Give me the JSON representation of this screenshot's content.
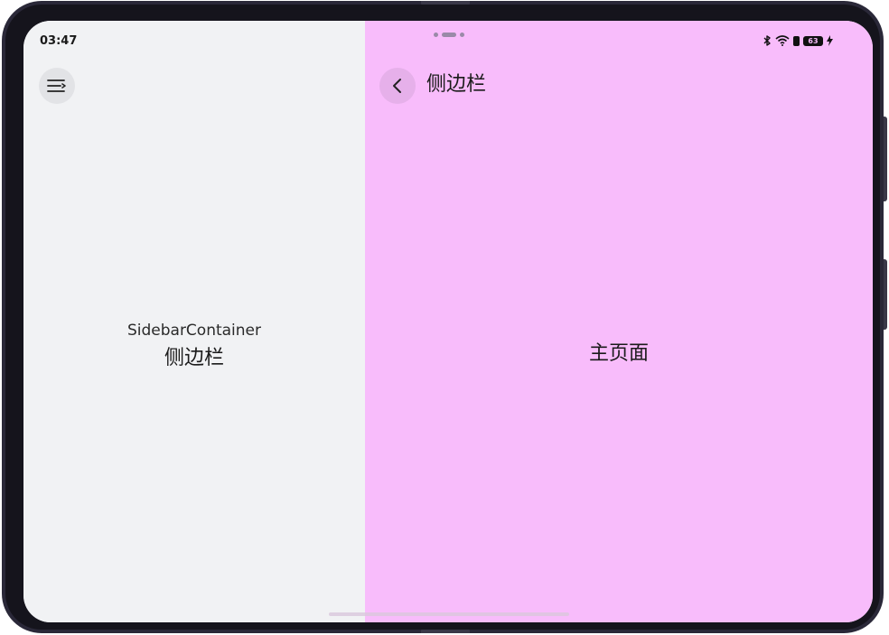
{
  "status_bar": {
    "time": "03:47",
    "battery_level": "63"
  },
  "sidebar": {
    "menu_icon": "menu-collapse-icon",
    "subtitle": "SidebarContainer",
    "label": "侧边栏",
    "background_color": "#f1f2f4"
  },
  "main": {
    "back_icon": "chevron-left-icon",
    "title": "侧边栏",
    "content_label": "主页面",
    "background_color": "#f8bcfb"
  }
}
